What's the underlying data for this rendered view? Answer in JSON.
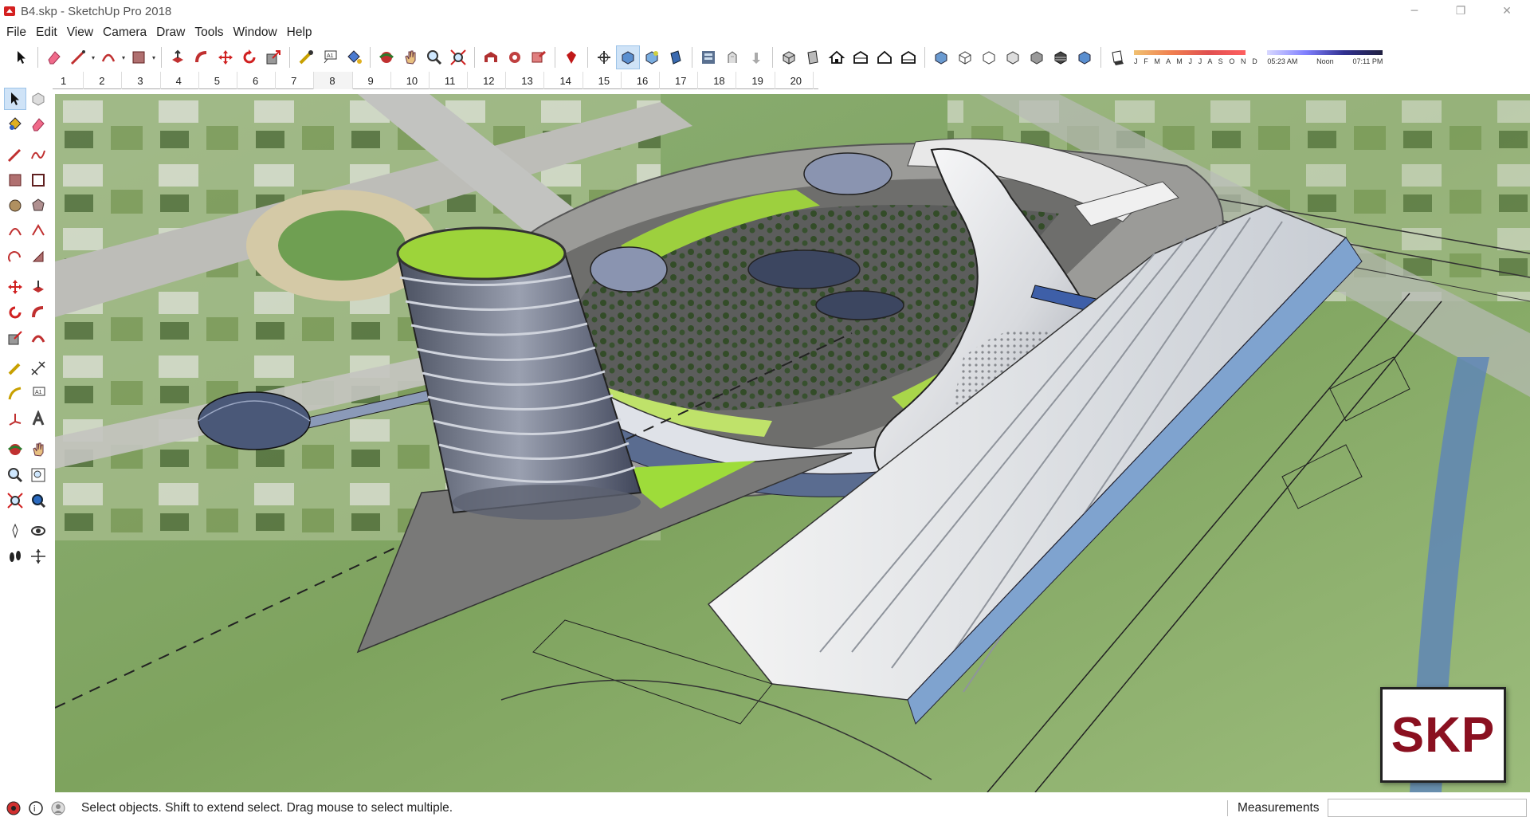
{
  "window": {
    "title": "B4.skp - SketchUp Pro 2018",
    "minimize": "─",
    "restore": "❐",
    "close": "✕"
  },
  "menu": [
    "File",
    "Edit",
    "View",
    "Camera",
    "Draw",
    "Tools",
    "Window",
    "Help"
  ],
  "scenes": [
    "1",
    "2",
    "3",
    "4",
    "5",
    "6",
    "7",
    "8",
    "9",
    "10",
    "11",
    "12",
    "13",
    "14",
    "15",
    "16",
    "17",
    "18",
    "19",
    "20"
  ],
  "current_scene": "8",
  "shadows": {
    "months": "J F M A M J J A S O N D",
    "time_start": "05:23 AM",
    "time_mid": "Noon",
    "time_end": "07:11 PM"
  },
  "status": {
    "hint": "Select objects. Shift to extend select. Drag mouse to select multiple.",
    "measurements_label": "Measurements",
    "measurements_value": ""
  },
  "watermark": "SKP",
  "colors": {
    "accent_active": "#cfe3f7",
    "logo_red": "#8a1020"
  }
}
